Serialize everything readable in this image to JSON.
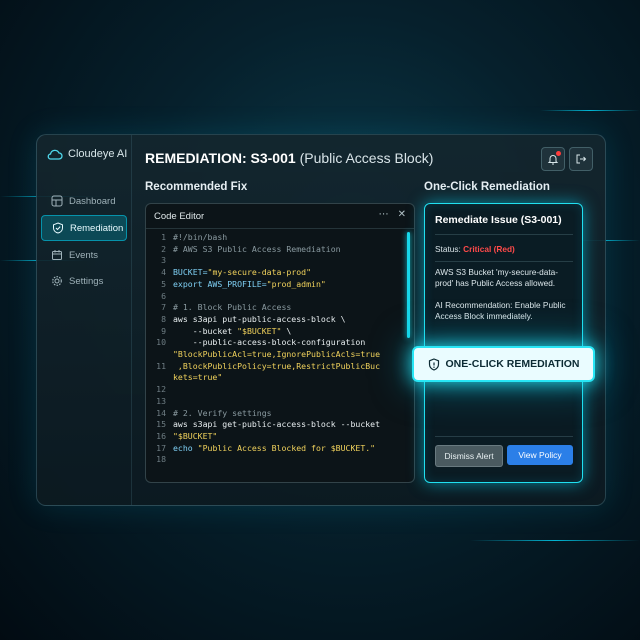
{
  "app": {
    "brand": "Cloudeye AI"
  },
  "sidebar": {
    "items": [
      {
        "label": "Dashboard",
        "icon": "dashboard-icon"
      },
      {
        "label": "Remediation",
        "icon": "shield-check-icon",
        "active": true
      },
      {
        "label": "Events",
        "icon": "calendar-icon"
      },
      {
        "label": "Settings",
        "icon": "gear-icon"
      }
    ]
  },
  "header": {
    "title_main": "REMEDIATION: S3-001",
    "title_sub": "(Public Access Block)",
    "notification_icon": "bell-icon",
    "logout_icon": "logout-icon"
  },
  "sections": {
    "recommended_fix": "Recommended Fix",
    "one_click": "One-Click Remediation"
  },
  "editor": {
    "title": "Code Editor",
    "more": "⋯",
    "close": "✕",
    "lines": [
      {
        "n": "1",
        "parts": [
          [
            "c-com",
            "#!/bin/bash"
          ]
        ]
      },
      {
        "n": "2",
        "parts": [
          [
            "c-com",
            "# AWS S3 Public Access Remediation"
          ]
        ]
      },
      {
        "n": "3",
        "parts": []
      },
      {
        "n": "4",
        "parts": [
          [
            "c-kw",
            "BUCKET="
          ],
          [
            "c-str",
            "\"my-secure-data-prod\""
          ]
        ]
      },
      {
        "n": "5",
        "parts": [
          [
            "c-kw",
            "export AWS_PROFILE="
          ],
          [
            "c-str",
            "\"prod_admin\""
          ]
        ]
      },
      {
        "n": "6",
        "parts": []
      },
      {
        "n": "7",
        "parts": [
          [
            "c-com",
            "# 1. Block Public Access"
          ]
        ]
      },
      {
        "n": "8",
        "parts": [
          [
            "c-txt",
            "aws s3api put-public-access-block \\"
          ]
        ]
      },
      {
        "n": "9",
        "parts": [
          [
            "c-txt",
            "    --bucket "
          ],
          [
            "c-str",
            "\"$BUCKET\""
          ],
          [
            "c-txt",
            " \\"
          ]
        ]
      },
      {
        "n": "10",
        "parts": [
          [
            "c-txt",
            "    --public-access-block-configuration"
          ]
        ]
      },
      {
        "n": "",
        "parts": [
          [
            "c-str",
            "\"BlockPublicAcl=true,IgnorePublicAcls=true"
          ]
        ]
      },
      {
        "n": "11",
        "parts": [
          [
            "c-str",
            " ,BlockPublicPolicy=true,RestrictPublicBuc"
          ]
        ]
      },
      {
        "n": "",
        "parts": [
          [
            "c-str",
            "kets=true\""
          ]
        ]
      },
      {
        "n": "12",
        "parts": []
      },
      {
        "n": "13",
        "parts": []
      },
      {
        "n": "14",
        "parts": [
          [
            "c-com",
            "# 2. Verify settings"
          ]
        ]
      },
      {
        "n": "15",
        "parts": [
          [
            "c-txt",
            "aws s3api get-public-access-block --bucket"
          ]
        ]
      },
      {
        "n": "16",
        "parts": [
          [
            "c-str",
            "\"$BUCKET\""
          ]
        ]
      },
      {
        "n": "17",
        "parts": [
          [
            "c-kw",
            "echo "
          ],
          [
            "c-str",
            "\"Public Access Blocked for $BUCKET.\""
          ]
        ]
      },
      {
        "n": "18",
        "parts": []
      }
    ]
  },
  "remediation": {
    "title": "Remediate Issue (S3-001)",
    "status_label": "Status: ",
    "status_value": "Critical (Red)",
    "description": "AWS S3 Bucket 'my-secure-data-prod' has Public Access allowed.",
    "ai_recommendation": "AI Recommendation: Enable Public Access Block immediately.",
    "one_click_button": "ONE-CLICK REMEDIATION",
    "dismiss_button": "Dismiss Alert",
    "view_button": "View Policy"
  },
  "colors": {
    "accent": "#21e0f0",
    "critical": "#ff4a4a",
    "primary_button": "#2b7fe8"
  }
}
